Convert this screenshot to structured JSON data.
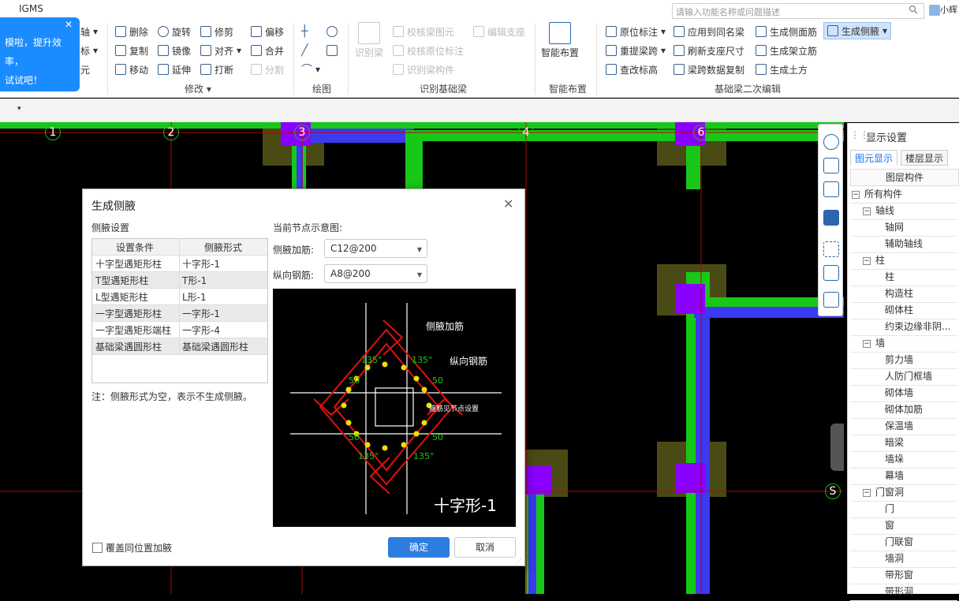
{
  "app": {
    "title": "IGMS",
    "search_placeholder": "请输入功能名称或问题描述",
    "user": "小辉"
  },
  "tip": {
    "line1": "模啦，提升效率，",
    "line2": "试试吧！",
    "close": "✕"
  },
  "ribbon": {
    "left_cut": [
      "轴",
      "标",
      "元"
    ],
    "modify": {
      "label": "修改",
      "items": [
        "删除",
        "旋转",
        "修剪",
        "偏移",
        "复制",
        "镜像",
        "对齐",
        "合并",
        "移动",
        "延伸",
        "打断",
        "分割"
      ]
    },
    "draw": {
      "label": "绘图"
    },
    "identify": {
      "label": "识别基础梁",
      "big": "识别梁",
      "items": [
        "校核梁图元",
        "编辑支座",
        "校核原位标注",
        "识别梁构件"
      ]
    },
    "smart": {
      "label": "智能布置",
      "big": "智能布置"
    },
    "edit2": {
      "label": "基础梁二次编辑",
      "items": [
        "原位标注",
        "应用到同名梁",
        "生成侧面筋",
        "生成侧腋",
        "重提梁跨",
        "刷新支座尺寸",
        "生成架立筋",
        "查改标高",
        "梁跨数据复制",
        "生成土方"
      ]
    }
  },
  "canvas": {
    "axes": [
      "1",
      "2",
      "3",
      "4",
      "6",
      "S"
    ]
  },
  "dialog": {
    "title": "生成侧腋",
    "close": "✕",
    "section": "侧腋设置",
    "col1": "设置条件",
    "col2": "侧腋形式",
    "rows": [
      {
        "cond": "十字型遇矩形柱",
        "form": "十字形-1"
      },
      {
        "cond": "T型遇矩形柱",
        "form": "T形-1"
      },
      {
        "cond": "L型遇矩形柱",
        "form": "L形-1"
      },
      {
        "cond": "一字型遇矩形柱",
        "form": "一字形-1"
      },
      {
        "cond": "一字型遇矩形端柱",
        "form": "一字形-4"
      },
      {
        "cond": "基础梁遇圆形柱",
        "form": "基础梁遇圆形柱"
      }
    ],
    "note": "注：侧腋形式为空，表示不生成侧腋。",
    "node_label": "当前节点示意图:",
    "haunch_rebar_label": "侧腋加筋:",
    "haunch_rebar": "C12@200",
    "long_rebar_label": "纵向钢筋:",
    "long_rebar": "A8@200",
    "diagram": {
      "haunch": "侧腋加筋",
      "longit": "纵向钢筋",
      "angle": "135°",
      "dist": "50",
      "section": "箍筋见节点设置",
      "shape": "十字形-1"
    },
    "overlap": "覆盖同位置加腋",
    "ok": "确定",
    "cancel": "取消"
  },
  "panel": {
    "title": "显示设置",
    "tab1": "图元显示",
    "tab2": "楼层显示",
    "header": "图层构件",
    "tree": [
      {
        "t": "所有构件",
        "lvl": 0,
        "box": "−"
      },
      {
        "t": "轴线",
        "lvl": 1,
        "box": "−"
      },
      {
        "t": "轴网",
        "lvl": 2
      },
      {
        "t": "辅助轴线",
        "lvl": 2
      },
      {
        "t": "柱",
        "lvl": 1,
        "box": "−"
      },
      {
        "t": "柱",
        "lvl": 2
      },
      {
        "t": "构造柱",
        "lvl": 2
      },
      {
        "t": "砌体柱",
        "lvl": 2
      },
      {
        "t": "约束边缘非阴...",
        "lvl": 2
      },
      {
        "t": "墙",
        "lvl": 1,
        "box": "−"
      },
      {
        "t": "剪力墙",
        "lvl": 2
      },
      {
        "t": "人防门框墙",
        "lvl": 2
      },
      {
        "t": "砌体墙",
        "lvl": 2
      },
      {
        "t": "砌体加筋",
        "lvl": 2
      },
      {
        "t": "保温墙",
        "lvl": 2
      },
      {
        "t": "暗梁",
        "lvl": 2
      },
      {
        "t": "墙垛",
        "lvl": 2
      },
      {
        "t": "幕墙",
        "lvl": 2
      },
      {
        "t": "门窗洞",
        "lvl": 1,
        "box": "−"
      },
      {
        "t": "门",
        "lvl": 2
      },
      {
        "t": "窗",
        "lvl": 2
      },
      {
        "t": "门联窗",
        "lvl": 2
      },
      {
        "t": "墙洞",
        "lvl": 2
      },
      {
        "t": "带形窗",
        "lvl": 2
      },
      {
        "t": "带形洞",
        "lvl": 2
      }
    ]
  },
  "colors": {
    "accent": "#2d7de0",
    "beam_green": "#18c818",
    "beam_blue": "#3a3af0",
    "column": "#8a00ff",
    "footing": "#4a4a14",
    "axis_red": "#c00000"
  }
}
